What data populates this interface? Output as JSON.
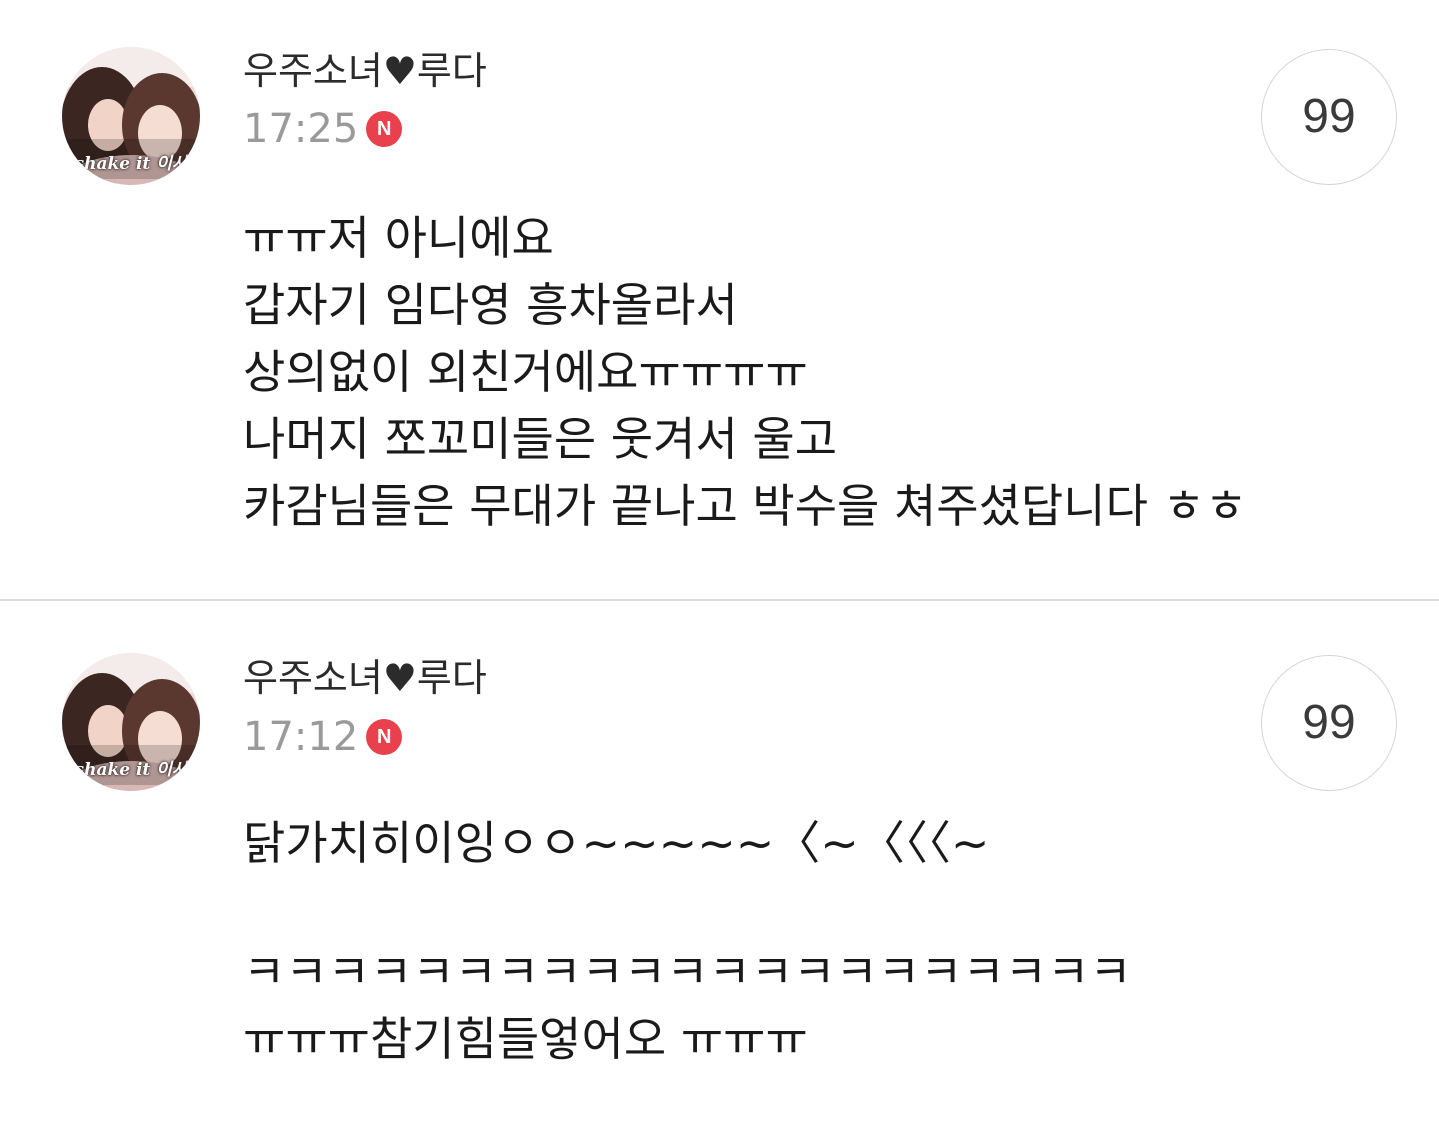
{
  "comments": [
    {
      "author": "우주소녀♥루다",
      "time": "17:25",
      "badge": "N",
      "reply_count": "99",
      "avatar_caption": "shake it 이사",
      "lines": [
        "ㅠㅠ저 아니에요",
        "갑자기 임다영 흥차올라서",
        "상의없이 외친거에요ㅠㅠㅠㅠ",
        "나머지 쪼꼬미들은 웃겨서 울고",
        "카감님들은 무대가 끝나고 박수을 쳐주셨답니다 ㅎㅎ"
      ]
    },
    {
      "author": "우주소녀♥루다",
      "time": "17:12",
      "badge": "N",
      "reply_count": "99",
      "avatar_caption": "shake it 이사",
      "lines": [
        "닭가치히이잉ㅇㅇ~~~~~〈~〈〈〈~",
        "",
        "ㅋㅋㅋㅋㅋㅋㅋㅋㅋㅋㅋㅋㅋㅋㅋㅋㅋㅋㅋㅋㅋ",
        "ㅠㅠㅠ참기힘들엏어오 ㅠㅠㅠ"
      ]
    }
  ],
  "colors": {
    "badge": "#e8404d",
    "time": "#9a9a9a",
    "divider": "#dcdcdc"
  }
}
